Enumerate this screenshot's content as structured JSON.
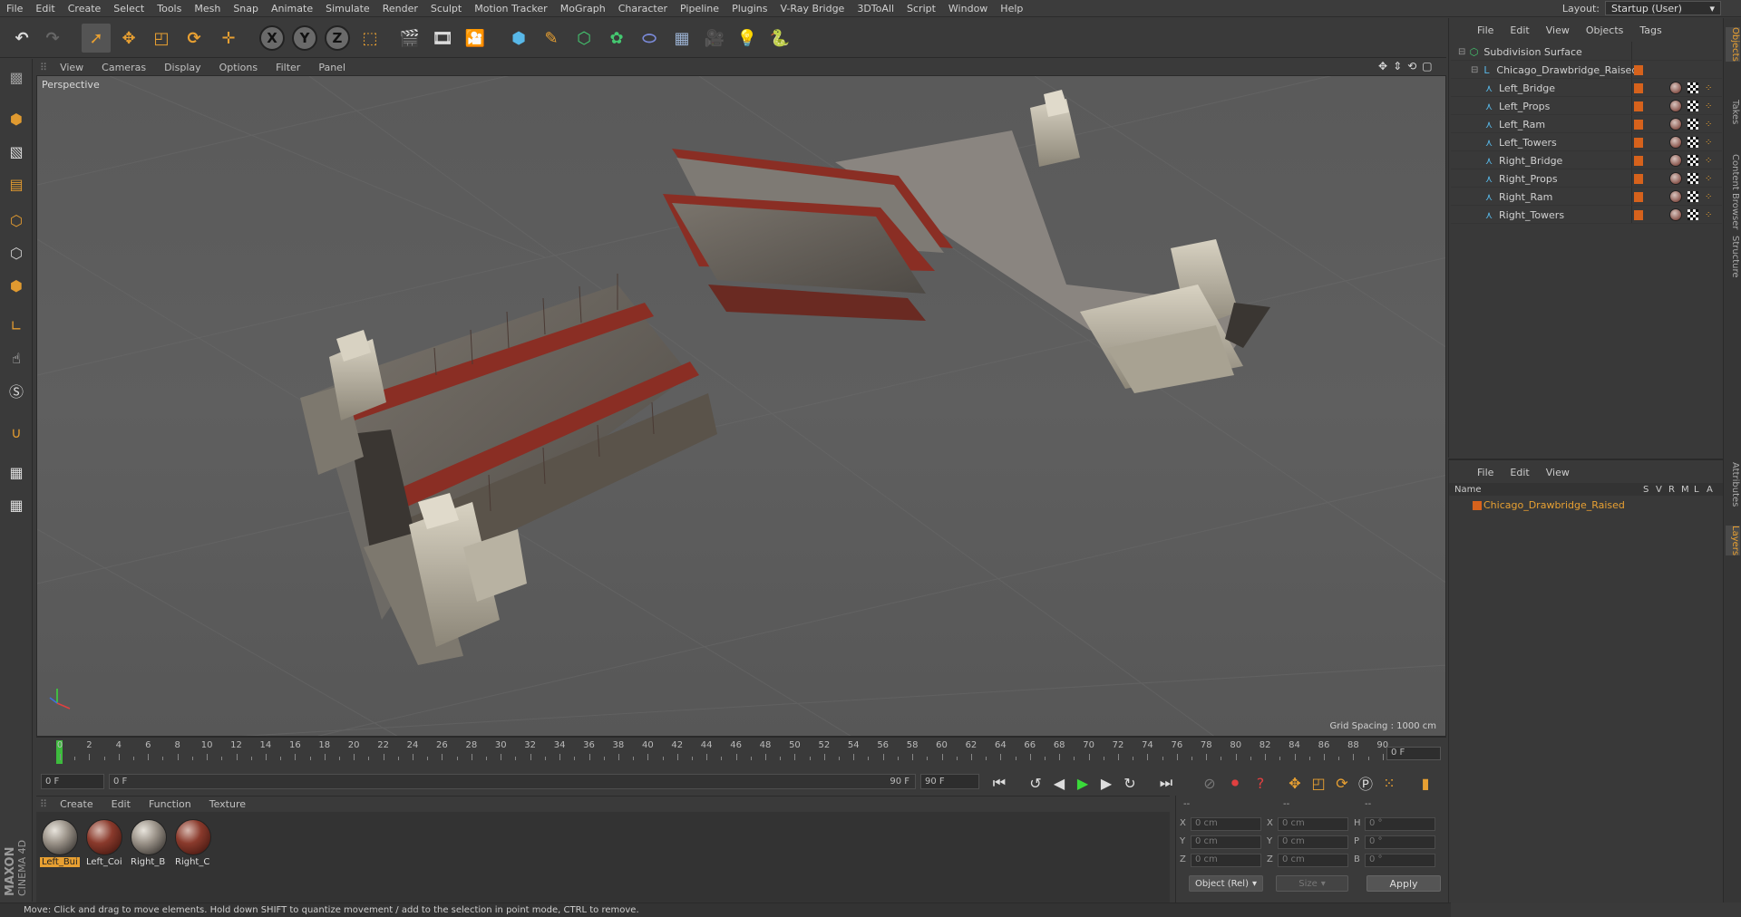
{
  "menu": [
    "File",
    "Edit",
    "Create",
    "Select",
    "Tools",
    "Mesh",
    "Snap",
    "Animate",
    "Simulate",
    "Render",
    "Sculpt",
    "Motion Tracker",
    "MoGraph",
    "Character",
    "Pipeline",
    "Plugins",
    "V-Ray Bridge",
    "3DToAll",
    "Script",
    "Window",
    "Help"
  ],
  "layout": {
    "label": "Layout:",
    "value": "Startup (User)"
  },
  "viewport": {
    "menu": [
      "View",
      "Cameras",
      "Display",
      "Options",
      "Filter",
      "Panel"
    ],
    "camera_label": "Perspective",
    "grid_spacing": "Grid Spacing : 1000 cm"
  },
  "timeline": {
    "ticks": [
      "0",
      "2",
      "4",
      "6",
      "8",
      "10",
      "12",
      "14",
      "16",
      "18",
      "20",
      "22",
      "24",
      "26",
      "28",
      "30",
      "32",
      "34",
      "36",
      "38",
      "40",
      "42",
      "44",
      "46",
      "48",
      "50",
      "52",
      "54",
      "56",
      "58",
      "60",
      "62",
      "64",
      "66",
      "68",
      "70",
      "72",
      "74",
      "76",
      "78",
      "80",
      "82",
      "84",
      "86",
      "88",
      "90"
    ],
    "frame_field": "0 F",
    "start_field": "0 F",
    "range_start": "0 F",
    "range_end": "90 F",
    "end_field": "90 F"
  },
  "materials": {
    "menu": [
      "Create",
      "Edit",
      "Function",
      "Texture"
    ],
    "items": [
      {
        "label": "Left_Bui",
        "style": "grey",
        "active": true
      },
      {
        "label": "Left_Coi",
        "style": "red",
        "active": false
      },
      {
        "label": "Right_B",
        "style": "grey",
        "active": false
      },
      {
        "label": "Right_C",
        "style": "red",
        "active": false
      }
    ]
  },
  "coords": {
    "headers": [
      "--",
      "--",
      "--"
    ],
    "rows": [
      {
        "a": "X",
        "av": "0 cm",
        "b": "X",
        "bv": "0 cm",
        "c": "H",
        "cv": "0 °"
      },
      {
        "a": "Y",
        "av": "0 cm",
        "b": "Y",
        "bv": "0 cm",
        "c": "P",
        "cv": "0 °"
      },
      {
        "a": "Z",
        "av": "0 cm",
        "b": "Z",
        "bv": "0 cm",
        "c": "B",
        "cv": "0 °"
      }
    ],
    "mode": "Object (Rel)",
    "size": "Size",
    "apply": "Apply"
  },
  "status": "Move: Click and drag to move elements. Hold down SHIFT to quantize movement / add to the selection in point mode, CTRL to remove.",
  "objects": {
    "menu": [
      "File",
      "Edit",
      "View",
      "Objects",
      "Tags"
    ],
    "tree": [
      {
        "name": "Subdivision Surface",
        "level": 0,
        "icon": "subdivision-icon"
      },
      {
        "name": "Chicago_Drawbridge_Raised",
        "level": 1,
        "icon": "null-icon"
      },
      {
        "name": "Left_Bridge",
        "level": 2,
        "icon": "polygon-icon"
      },
      {
        "name": "Left_Props",
        "level": 2,
        "icon": "polygon-icon"
      },
      {
        "name": "Left_Ram",
        "level": 2,
        "icon": "polygon-icon"
      },
      {
        "name": "Left_Towers",
        "level": 2,
        "icon": "polygon-icon"
      },
      {
        "name": "Right_Bridge",
        "level": 2,
        "icon": "polygon-icon"
      },
      {
        "name": "Right_Props",
        "level": 2,
        "icon": "polygon-icon"
      },
      {
        "name": "Right_Ram",
        "level": 2,
        "icon": "polygon-icon"
      },
      {
        "name": "Right_Towers",
        "level": 2,
        "icon": "polygon-icon"
      }
    ]
  },
  "layers": {
    "menu": [
      "File",
      "Edit",
      "View"
    ],
    "columns": [
      "Name",
      "S",
      "V",
      "R",
      "M",
      "L",
      "A"
    ],
    "row": "Chicago_Drawbridge_Raised"
  },
  "edge_tabs": [
    "Objects",
    "Takes",
    "Content Browser",
    "Structure",
    "Attributes",
    "Layers"
  ],
  "colors": {
    "accent": "#e8a032",
    "layer": "#d6621c",
    "timeline_cursor": "#3dbb3d"
  }
}
